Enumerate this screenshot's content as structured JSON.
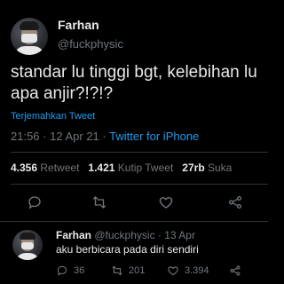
{
  "tweet": {
    "display_name": "Farhan",
    "handle": "@fuckphysic",
    "text": "standar lu tinggi bgt, kelebihan lu apa anjir?!?!?",
    "translate_label": "Terjemahkan Tweet",
    "time": "21:56",
    "date": "12 Apr 21",
    "source": "Twitter for iPhone"
  },
  "stats": {
    "retweets_count": "4.356",
    "retweets_label": "Retweet",
    "quotes_count": "1.421",
    "quotes_label": "Kutip Tweet",
    "likes_count": "27rb",
    "likes_label": "Suka"
  },
  "actions": [
    "reply-icon",
    "retweet-icon",
    "like-icon",
    "share-icon"
  ],
  "reply": {
    "display_name": "Farhan",
    "handle": "@fuckphysic",
    "date": "13 Apr",
    "text": "aku berbicara pada diri sendiri",
    "reply_count": "36",
    "retweet_count": "201",
    "like_count": "3.394"
  },
  "colors": {
    "background": "#000000",
    "muted": "#71767b",
    "link": "#1d9bf0",
    "text": "#e7e9ea"
  }
}
